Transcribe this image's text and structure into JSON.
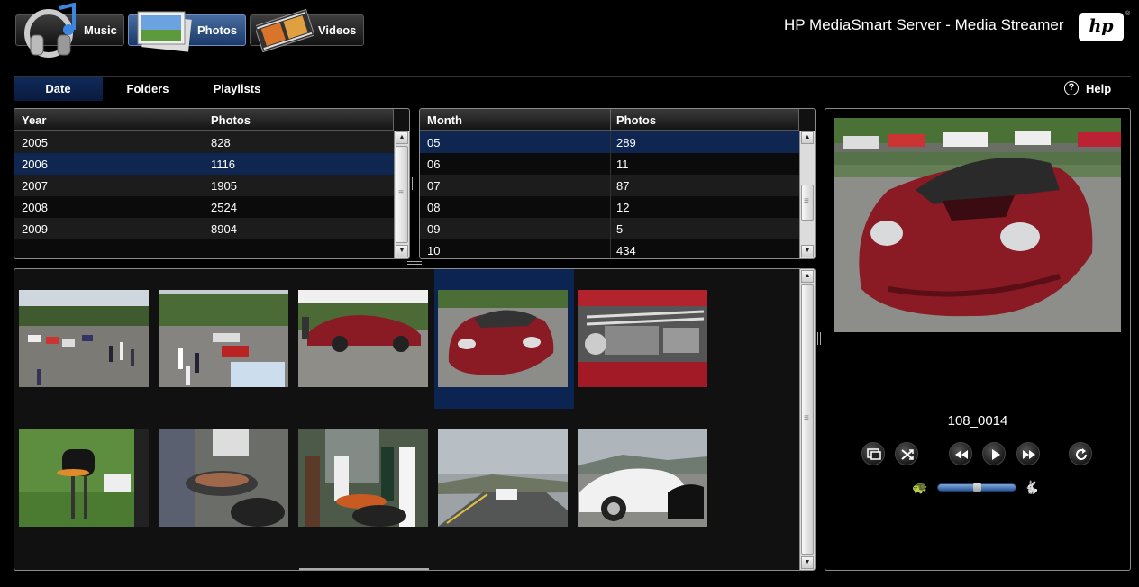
{
  "app": {
    "title": "HP MediaSmart Server - Media Streamer",
    "logo_text": "hp",
    "logo_reg": "®"
  },
  "media_tabs": [
    {
      "label": "Music",
      "icon": "headphones-icon",
      "active": false
    },
    {
      "label": "Photos",
      "icon": "photos-icon",
      "active": true
    },
    {
      "label": "Videos",
      "icon": "film-strip-icon",
      "active": false
    }
  ],
  "subnav": {
    "tabs": [
      {
        "label": "Date",
        "active": true
      },
      {
        "label": "Folders",
        "active": false
      },
      {
        "label": "Playlists",
        "active": false
      }
    ],
    "help_label": "Help",
    "help_icon": "question-icon"
  },
  "year_grid": {
    "columns": [
      "Year",
      "Photos"
    ],
    "rows": [
      {
        "year": "2005",
        "photos": "828"
      },
      {
        "year": "2006",
        "photos": "1116"
      },
      {
        "year": "2007",
        "photos": "1905"
      },
      {
        "year": "2008",
        "photos": "2524"
      },
      {
        "year": "2009",
        "photos": "8904"
      }
    ],
    "selected": "2006"
  },
  "month_grid": {
    "columns": [
      "Month",
      "Photos"
    ],
    "rows": [
      {
        "month": "05",
        "photos": "289"
      },
      {
        "month": "06",
        "photos": "11"
      },
      {
        "month": "07",
        "photos": "87"
      },
      {
        "month": "08",
        "photos": "12"
      },
      {
        "month": "09",
        "photos": "5"
      },
      {
        "month": "10",
        "photos": "434"
      }
    ],
    "selected": "05"
  },
  "thumbnails": [
    {
      "scene": "parking-lot-crowd"
    },
    {
      "scene": "parked-cars-crowd"
    },
    {
      "scene": "red-sports-car-side"
    },
    {
      "scene": "red-sports-car-front",
      "selected": true
    },
    {
      "scene": "engine-bay"
    },
    {
      "scene": "bbq-grill"
    },
    {
      "scene": "people-grilling"
    },
    {
      "scene": "grill-smoke-crowd"
    },
    {
      "scene": "highway-white-car"
    },
    {
      "scene": "white-car-closeup"
    }
  ],
  "viewer": {
    "photo_name": "108_0014",
    "controls": [
      "display-icon",
      "shuffle-icon",
      "rewind-icon",
      "play-icon",
      "fast-forward-icon",
      "repeat-icon"
    ],
    "speed_slow_icon": "turtle-icon",
    "speed_fast_icon": "rabbit-icon",
    "slow_glyph": "🐢",
    "fast_glyph": "🐇",
    "speed_fraction": 0.5
  },
  "colors": {
    "selection": "#0f2750",
    "active_tab": "#1a3a6a",
    "car_red": "#8a1a24"
  }
}
